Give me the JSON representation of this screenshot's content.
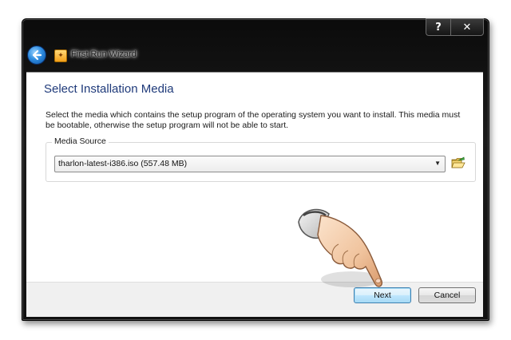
{
  "window": {
    "title": "First Run Wizard",
    "caption_buttons": {
      "help": "?",
      "close": "✕"
    }
  },
  "page": {
    "title": "Select Installation Media",
    "description_line1": "Select the media which contains the setup program of the operating system you want to install. This media must",
    "description_line2": "be bootable, otherwise the setup program will not be able to start."
  },
  "media_source": {
    "group_label": "Media Source",
    "selected_value": "tharlon-latest-i386.iso (557.48 MB)"
  },
  "buttons": {
    "next": "Next",
    "cancel": "Cancel"
  },
  "icons": {
    "back": "back-arrow-icon",
    "wizard": "wizard-icon",
    "folder": "folder-open-icon",
    "dropdown": "chevron-down-icon",
    "pointer": "pointing-hand-icon"
  },
  "colors": {
    "title_blue": "#1f3a7a",
    "frame_dark": "#111111",
    "next_accent": "#3c7fb1"
  }
}
